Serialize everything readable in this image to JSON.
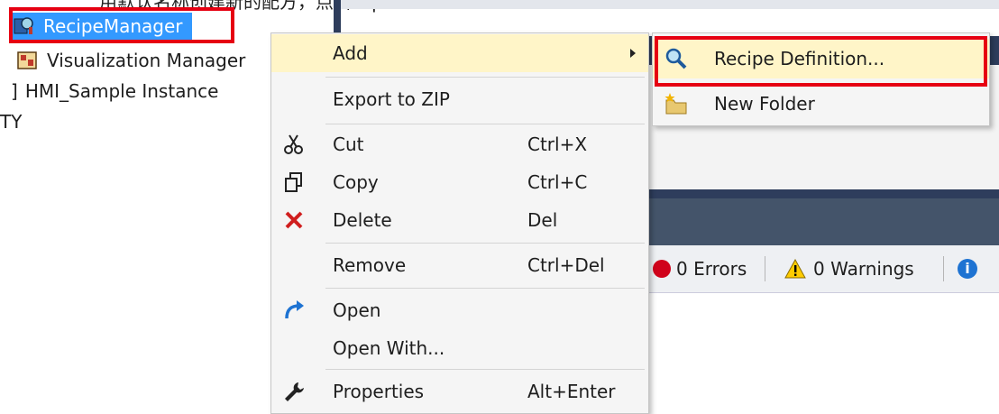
{
  "caption": "用默认名称创建新的配方，点击 Open",
  "tree": {
    "items": [
      {
        "label": "RecipeManager"
      },
      {
        "label": "Visualization Manager"
      },
      {
        "label": "HMI_Sample Instance"
      },
      {
        "label": "TY"
      }
    ]
  },
  "context_menu": {
    "items": [
      {
        "label": "Add",
        "shortcut": ""
      },
      {
        "label": "Export to ZIP",
        "shortcut": ""
      },
      {
        "label": "Cut",
        "shortcut": "Ctrl+X"
      },
      {
        "label": "Copy",
        "shortcut": "Ctrl+C"
      },
      {
        "label": "Delete",
        "shortcut": "Del"
      },
      {
        "label": "Remove",
        "shortcut": "Ctrl+Del"
      },
      {
        "label": "Open",
        "shortcut": ""
      },
      {
        "label": "Open With...",
        "shortcut": ""
      },
      {
        "label": "Properties",
        "shortcut": "Alt+Enter"
      }
    ]
  },
  "submenu": {
    "items": [
      {
        "label": "Recipe Definition..."
      },
      {
        "label": "New Folder"
      }
    ]
  },
  "error_list": {
    "errors": "0 Errors",
    "warnings": "0 Warnings"
  },
  "colors": {
    "highlight_red": "#e60012",
    "selection_blue": "#3399ff",
    "menu_hover": "#fff5c8",
    "dark_panel": "#2e3d5c"
  }
}
